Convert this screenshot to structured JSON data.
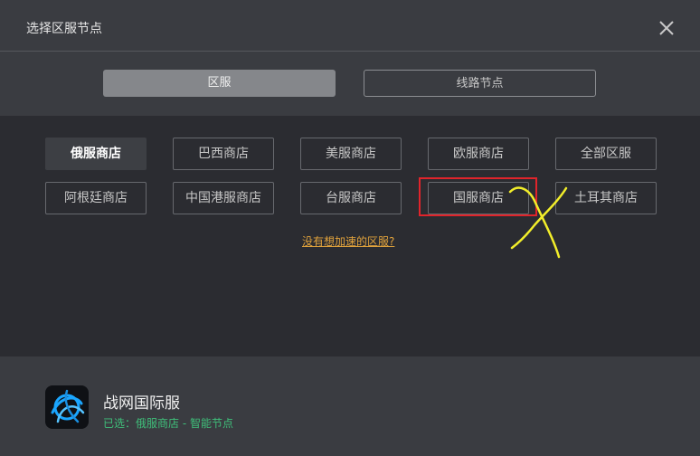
{
  "dialog": {
    "title": "选择区服节点",
    "close_icon": "close-icon"
  },
  "tabs": [
    {
      "label": "区服",
      "active": true
    },
    {
      "label": "线路节点",
      "active": false
    }
  ],
  "regions": [
    {
      "label": "俄服商店",
      "selected": true
    },
    {
      "label": "巴西商店",
      "selected": false
    },
    {
      "label": "美服商店",
      "selected": false
    },
    {
      "label": "欧服商店",
      "selected": false
    },
    {
      "label": "全部区服",
      "selected": false
    },
    {
      "label": "阿根廷商店",
      "selected": false
    },
    {
      "label": "中国港服商店",
      "selected": false
    },
    {
      "label": "台服商店",
      "selected": false
    },
    {
      "label": "国服商店",
      "selected": false
    },
    {
      "label": "土耳其商店",
      "selected": false
    }
  ],
  "missing_region_link": "没有想加速的区服?",
  "annotations": {
    "highlight_color": "#e0242b",
    "scribble_color": "#f2ee2a"
  },
  "footer": {
    "app_name": "战网国际服",
    "status": "已选：俄服商店 - 智能节点",
    "app_icon": "battlenet-icon"
  },
  "colors": {
    "accent_link": "#e0a23c",
    "status_green": "#3fbf7a"
  }
}
